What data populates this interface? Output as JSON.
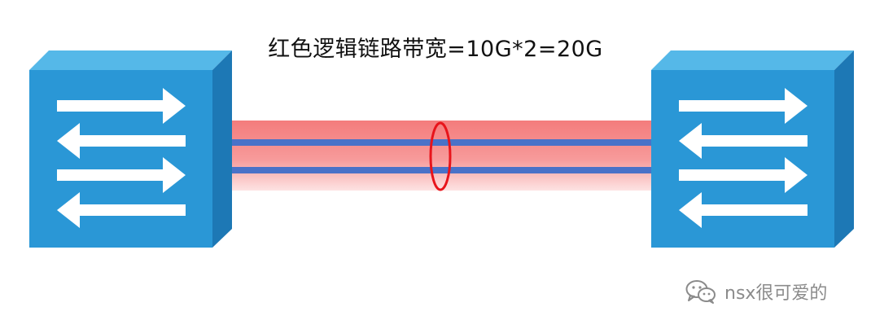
{
  "diagram": {
    "title": "红色逻辑链路带宽=10G*2=20G",
    "nodes": [
      {
        "id": "switch-left",
        "icon": "switch-icon"
      },
      {
        "id": "switch-right",
        "icon": "switch-icon"
      }
    ],
    "links": [
      {
        "from": "switch-left",
        "to": "switch-right",
        "kind": "physical-link",
        "color": "#4a72c8"
      },
      {
        "from": "switch-left",
        "to": "switch-right",
        "kind": "physical-link",
        "color": "#4a72c8"
      }
    ],
    "logical_link": {
      "color": "#f47c7c",
      "bundle_marker": "red-ellipse",
      "marker_color": "#e8141b"
    },
    "colors": {
      "switch_front": "#2a97d6",
      "switch_top": "#55b8e8",
      "switch_side": "#1d78b5",
      "arrow": "#ffffff"
    }
  },
  "watermark": {
    "icon": "wechat-icon",
    "text": "nsx很可爱的"
  }
}
